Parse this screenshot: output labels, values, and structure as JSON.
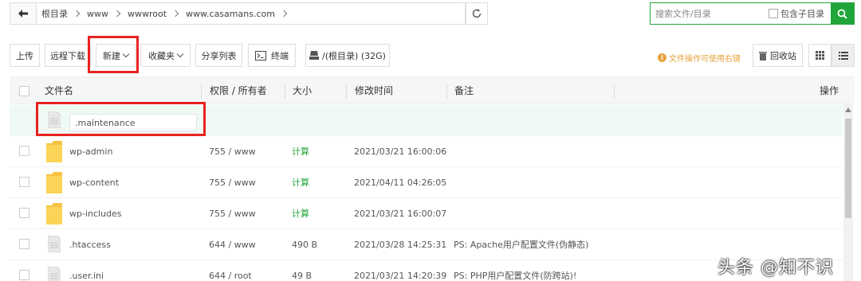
{
  "address": {
    "crumbs": [
      "根目录",
      "www",
      "wwwroot",
      "www.casamans.com"
    ]
  },
  "search": {
    "placeholder": "搜索文件/目录",
    "include_sub_label": "包含子目录"
  },
  "toolbar": {
    "upload": "上传",
    "remote_download": "远程下载",
    "new": "新建",
    "favorites": "收藏夹",
    "share_list": "分享列表",
    "terminal": "终端",
    "disk": "/(根目录) (32G)",
    "tip": "文件操作可使用右键",
    "recycle": "回收站"
  },
  "table": {
    "headers": {
      "name": "文件名",
      "perm": "权限 / 所有者",
      "size": "大小",
      "mtime": "修改时间",
      "note": "备注",
      "ops": "操作"
    },
    "new_file_value": ".maintenance",
    "rows": [
      {
        "name": "wp-admin",
        "type": "folder",
        "perm": "755 / www",
        "size": "计算",
        "mtime": "2021/03/21 16:00:06",
        "note": ""
      },
      {
        "name": "wp-content",
        "type": "folder",
        "perm": "755 / www",
        "size": "计算",
        "mtime": "2021/04/11 04:26:05",
        "note": ""
      },
      {
        "name": "wp-includes",
        "type": "folder",
        "perm": "755 / www",
        "size": "计算",
        "mtime": "2021/03/21 16:00:07",
        "note": ""
      },
      {
        "name": ".htaccess",
        "type": "file",
        "perm": "644 / www",
        "size": "490 B",
        "mtime": "2021/03/28 14:25:31",
        "note": "PS: Apache用户配置文件(伪静态)"
      },
      {
        "name": ".user.ini",
        "type": "file",
        "perm": "644 / root",
        "size": "49 B",
        "mtime": "2021/03/21 14:20:39",
        "note": "PS: PHP用户配置文件(防跨站)!"
      }
    ]
  },
  "watermark": "头条 @知不识",
  "colors": {
    "accent": "#20a53a",
    "highlight": "#e8231f",
    "tip": "#e6a23c",
    "folder": "#f5c242"
  }
}
